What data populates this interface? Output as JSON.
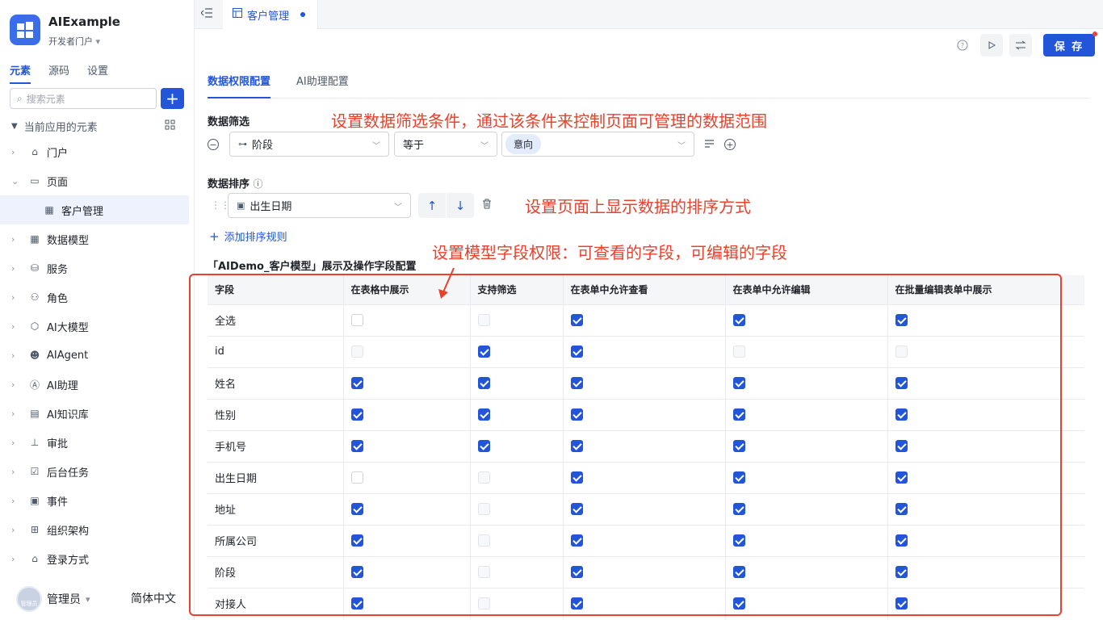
{
  "app": {
    "name": "AIExample",
    "portal": "开发者门户"
  },
  "sidebar": {
    "tabs": [
      "元素",
      "源码",
      "设置"
    ],
    "search_placeholder": "搜索元素",
    "add_label": "+",
    "tree_title": "当前应用的元素",
    "items": [
      {
        "label": "门户",
        "icon": "home-icon"
      },
      {
        "label": "页面",
        "icon": "page-icon",
        "expanded": true
      },
      {
        "label": "客户管理",
        "icon": "table-icon",
        "child": true,
        "selected": true
      },
      {
        "label": "数据模型",
        "icon": "grid-icon"
      },
      {
        "label": "服务",
        "icon": "service-icon"
      },
      {
        "label": "角色",
        "icon": "role-icon"
      },
      {
        "label": "AI大模型",
        "icon": "model-icon"
      },
      {
        "label": "AIAgent",
        "icon": "robot-icon"
      },
      {
        "label": "AI助理",
        "icon": "assistant-icon"
      },
      {
        "label": "AI知识库",
        "icon": "book-icon"
      },
      {
        "label": "审批",
        "icon": "stamp-icon"
      },
      {
        "label": "后台任务",
        "icon": "task-icon"
      },
      {
        "label": "事件",
        "icon": "event-icon"
      },
      {
        "label": "组织架构",
        "icon": "org-icon"
      },
      {
        "label": "登录方式",
        "icon": "login-icon"
      }
    ],
    "user": {
      "name": "管理员",
      "avatar_text": "管理员"
    },
    "language": "简体中文"
  },
  "topbar": {
    "tab_title": "客户管理"
  },
  "toolbar": {
    "save_label": "保 存"
  },
  "content": {
    "tabs": [
      "数据权限配置",
      "AI助理配置"
    ],
    "filter": {
      "title": "数据筛选",
      "field": "阶段",
      "operator": "等于",
      "value": "意向"
    },
    "sort": {
      "title": "数据排序",
      "field": "出生日期",
      "add_rule": "添加排序规则"
    },
    "table_title": "「AIDemo_客户模型」展示及操作字段配置",
    "annotations": {
      "filter": "设置数据筛选条件，通过该条件来控制页面可管理的数据范围",
      "sort": "设置页面上显示数据的排序方式",
      "fields": "设置模型字段权限：可查看的字段，可编辑的字段"
    },
    "columns": [
      "字段",
      "在表格中展示",
      "支持筛选",
      "在表单中允许查看",
      "在表单中允许编辑",
      "在批量编辑表单中展示"
    ],
    "rows": [
      {
        "field": "全选",
        "states": [
          "off",
          "dis",
          "on",
          "on",
          "on"
        ]
      },
      {
        "field": "id",
        "states": [
          "dis",
          "on",
          "on",
          "dis",
          "dis"
        ]
      },
      {
        "field": "姓名",
        "states": [
          "on",
          "on",
          "on",
          "on",
          "on"
        ]
      },
      {
        "field": "性别",
        "states": [
          "on",
          "on",
          "on",
          "on",
          "on"
        ]
      },
      {
        "field": "手机号",
        "states": [
          "on",
          "on",
          "on",
          "on",
          "on"
        ]
      },
      {
        "field": "出生日期",
        "states": [
          "off",
          "dis",
          "on",
          "on",
          "on"
        ]
      },
      {
        "field": "地址",
        "states": [
          "on",
          "dis",
          "on",
          "on",
          "on"
        ]
      },
      {
        "field": "所属公司",
        "states": [
          "on",
          "dis",
          "on",
          "on",
          "on"
        ]
      },
      {
        "field": "阶段",
        "states": [
          "on",
          "dis",
          "on",
          "on",
          "on"
        ]
      },
      {
        "field": "对接人",
        "states": [
          "on",
          "dis",
          "on",
          "on",
          "on"
        ]
      }
    ]
  }
}
